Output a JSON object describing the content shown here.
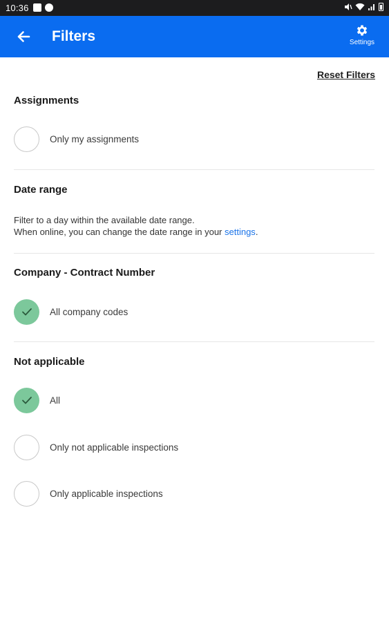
{
  "status_bar": {
    "time": "10:36"
  },
  "app_bar": {
    "title": "Filters",
    "back_icon": "arrow-left-icon",
    "settings_icon": "gear-icon",
    "settings_label": "Settings"
  },
  "reset_filters_label": "Reset Filters",
  "sections": {
    "assignments": {
      "title": "Assignments",
      "options": [
        {
          "label": "Only my assignments",
          "checked": false
        }
      ]
    },
    "date_range": {
      "title": "Date range",
      "description_line1": "Filter to a day within the available date range.",
      "description_line2_prefix": "When online, you can change the date range in your ",
      "description_link": "settings",
      "description_suffix": "."
    },
    "company": {
      "title": "Company - Contract Number",
      "options": [
        {
          "label": "All company codes",
          "checked": true
        }
      ]
    },
    "not_applicable": {
      "title": "Not applicable",
      "options": [
        {
          "label": "All",
          "checked": true
        },
        {
          "label": "Only not applicable inspections",
          "checked": false
        },
        {
          "label": "Only applicable inspections",
          "checked": false
        }
      ]
    }
  },
  "colors": {
    "app_bar": "#0a6cf0",
    "status_bar": "#1c1c1e",
    "checked_radio": "#7cc89b",
    "link": "#1a73e8"
  }
}
